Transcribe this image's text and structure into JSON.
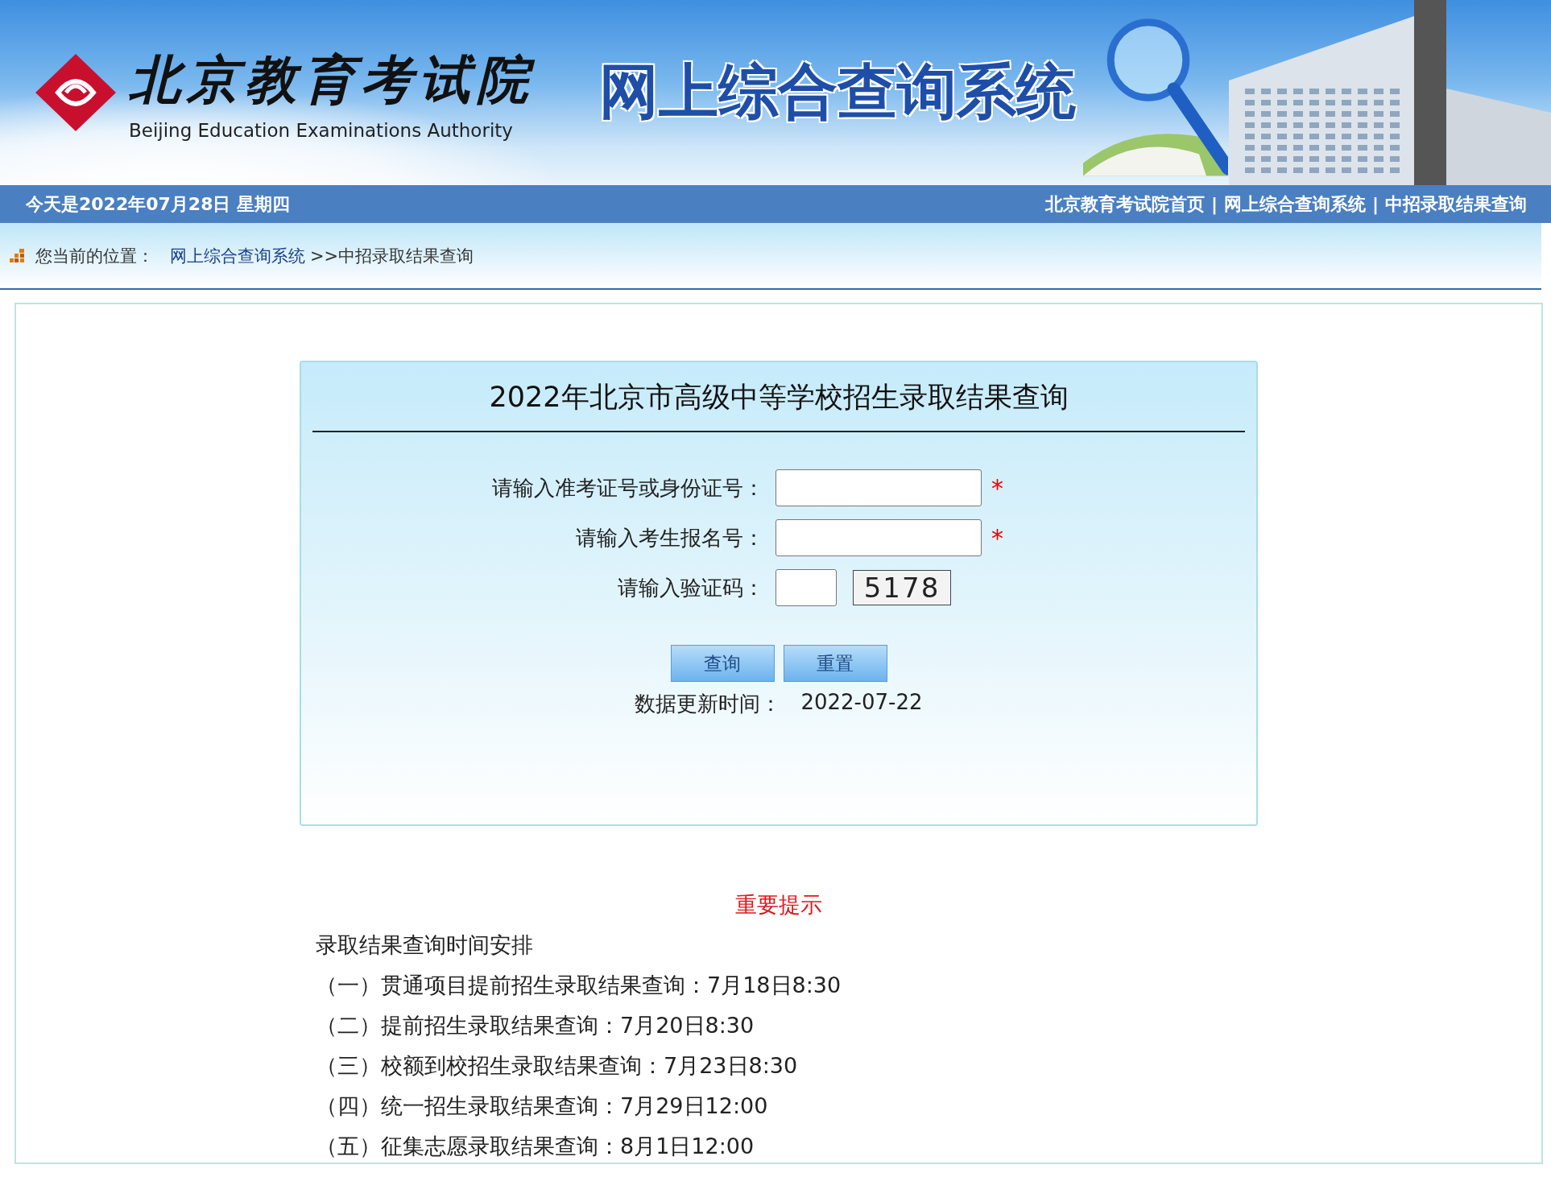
{
  "banner": {
    "org_name": "北京教育考试院",
    "org_name_en": "Beijing Education Examinations Authority",
    "system_title": "网上综合查询系统"
  },
  "top_bar": {
    "date": "今天是2022年07月28日 星期四",
    "links": [
      "北京教育考试院首页",
      "网上综合查询系统",
      "中招录取结果查询"
    ],
    "separator": "|"
  },
  "breadcrumb": {
    "label": "您当前的位置：",
    "link": "网上综合查询系统",
    "current": ">>中招录取结果查询"
  },
  "form": {
    "title": "2022年北京市高级中等学校招生录取结果查询",
    "fields": [
      {
        "kind": "text",
        "label": "请输入准考证号或身份证号：",
        "required_mark": "*"
      },
      {
        "kind": "text",
        "label": "请输入考生报名号：",
        "required_mark": "*"
      },
      {
        "kind": "captcha",
        "label": "请输入验证码：",
        "captcha_text": "5178"
      }
    ],
    "buttons": [
      "查询",
      "重置"
    ],
    "update_label": "数据更新时间：",
    "update_value": "2022-07-22"
  },
  "notice": {
    "heading": "重要提示",
    "subtitle": "录取结果查询时间安排",
    "items": [
      "（一）贯通项目提前招生录取结果查询：7月18日8:30",
      "（二）提前招生录取结果查询：7月20日8:30",
      "（三）校额到校招生录取结果查询：7月23日8:30",
      "（四）统一招生录取结果查询：7月29日12:00",
      "（五）征集志愿录取结果查询：8月1日12:00"
    ]
  }
}
